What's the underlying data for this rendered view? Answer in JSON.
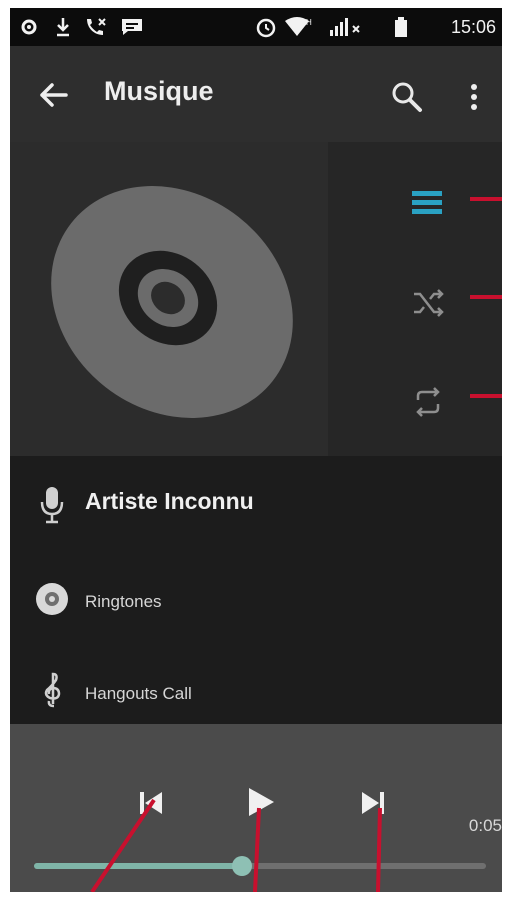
{
  "status_bar": {
    "time": "15:06",
    "icons": [
      "settings-icon",
      "download-icon",
      "missed-call-icon",
      "message-icon",
      "alarm-icon",
      "wifi-icon",
      "signal-icon",
      "battery-icon"
    ]
  },
  "app_bar": {
    "title": "Musique",
    "icons": [
      "back-arrow-icon",
      "search-icon",
      "more-vert-icon"
    ]
  },
  "album_art": {
    "icon": "disc-icon"
  },
  "side_controls": [
    {
      "name": "playlist",
      "icon": "queue-list-icon",
      "active": true
    },
    {
      "name": "shuffle",
      "icon": "shuffle-icon",
      "active": false
    },
    {
      "name": "repeat",
      "icon": "repeat-icon",
      "active": false
    }
  ],
  "list": {
    "artist": "Artiste Inconnu",
    "items": [
      {
        "label": "Ringtones",
        "icon": "disc-small-icon"
      },
      {
        "label": "Hangouts Call",
        "icon": "treble-clef-icon"
      }
    ]
  },
  "player": {
    "time": "0:05",
    "progress": 0.46,
    "controls": [
      "previous-icon",
      "play-icon",
      "next-icon"
    ]
  },
  "colors": {
    "accent": "#2aa1c2",
    "progress": "#7fb5a8",
    "annotation": "#c8102e",
    "background": "#1f1f1f"
  }
}
